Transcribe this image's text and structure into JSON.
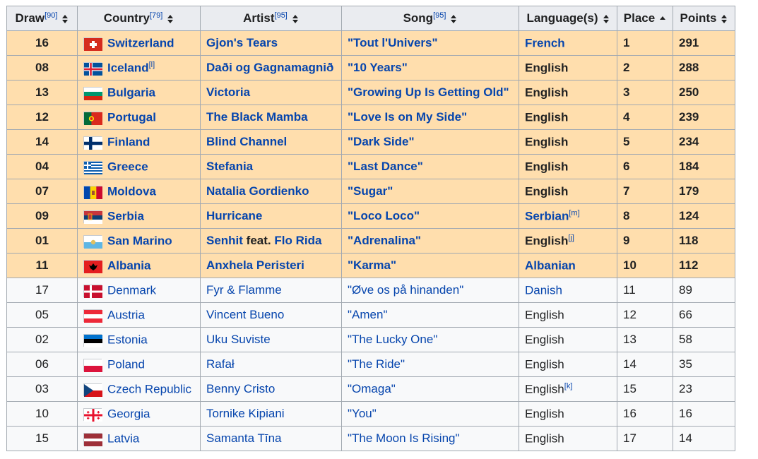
{
  "headers": [
    {
      "label": "Draw",
      "ref": "[90]",
      "sort": "both"
    },
    {
      "label": "Country",
      "ref": "[79]",
      "sort": "both"
    },
    {
      "label": "Artist",
      "ref": "[95]",
      "sort": "both"
    },
    {
      "label": "Song",
      "ref": "[95]",
      "sort": "both"
    },
    {
      "label": "Language(s)",
      "ref": "",
      "sort": "both"
    },
    {
      "label": "Place",
      "ref": "",
      "sort": "asc"
    },
    {
      "label": "Points",
      "ref": "",
      "sort": "both"
    }
  ],
  "rows": [
    {
      "draw": "16",
      "country": "Switzerland",
      "country_ref": "",
      "flag": "switzerland",
      "artist": "Gjon's Tears",
      "artist_feat": "",
      "artist_feat2": "",
      "song": "\"Tout l'Univers\"",
      "language": "French",
      "language_link": true,
      "language_ref": "",
      "place": "1",
      "points": "291",
      "qualified": true
    },
    {
      "draw": "08",
      "country": "Iceland",
      "country_ref": "[l]",
      "flag": "iceland",
      "artist": "Daði og Gagnamagnið",
      "artist_feat": "",
      "artist_feat2": "",
      "song": "\"10 Years\"",
      "language": "English",
      "language_link": false,
      "language_ref": "",
      "place": "2",
      "points": "288",
      "qualified": true
    },
    {
      "draw": "13",
      "country": "Bulgaria",
      "country_ref": "",
      "flag": "bulgaria",
      "artist": "Victoria",
      "artist_feat": "",
      "artist_feat2": "",
      "song": "\"Growing Up Is Getting Old\"",
      "language": "English",
      "language_link": false,
      "language_ref": "",
      "place": "3",
      "points": "250",
      "qualified": true
    },
    {
      "draw": "12",
      "country": "Portugal",
      "country_ref": "",
      "flag": "portugal",
      "artist": "The Black Mamba",
      "artist_feat": "",
      "artist_feat2": "",
      "song": "\"Love Is on My Side\"",
      "language": "English",
      "language_link": false,
      "language_ref": "",
      "place": "4",
      "points": "239",
      "qualified": true
    },
    {
      "draw": "14",
      "country": "Finland",
      "country_ref": "",
      "flag": "finland",
      "artist": "Blind Channel",
      "artist_feat": "",
      "artist_feat2": "",
      "song": "\"Dark Side\"",
      "language": "English",
      "language_link": false,
      "language_ref": "",
      "place": "5",
      "points": "234",
      "qualified": true
    },
    {
      "draw": "04",
      "country": "Greece",
      "country_ref": "",
      "flag": "greece",
      "artist": "Stefania",
      "artist_feat": "",
      "artist_feat2": "",
      "song": "\"Last Dance\"",
      "language": "English",
      "language_link": false,
      "language_ref": "",
      "place": "6",
      "points": "184",
      "qualified": true
    },
    {
      "draw": "07",
      "country": "Moldova",
      "country_ref": "",
      "flag": "moldova",
      "artist": "Natalia Gordienko",
      "artist_feat": "",
      "artist_feat2": "",
      "song": "\"Sugar\"",
      "language": "English",
      "language_link": false,
      "language_ref": "",
      "place": "7",
      "points": "179",
      "qualified": true
    },
    {
      "draw": "09",
      "country": "Serbia",
      "country_ref": "",
      "flag": "serbia",
      "artist": "Hurricane",
      "artist_feat": "",
      "artist_feat2": "",
      "song": "\"Loco Loco\"",
      "language": "Serbian",
      "language_link": true,
      "language_ref": "[m]",
      "place": "8",
      "points": "124",
      "qualified": true
    },
    {
      "draw": "01",
      "country": "San Marino",
      "country_ref": "",
      "flag": "sanmarino",
      "artist": "Senhit",
      "artist_feat": " feat. ",
      "artist_feat2": "Flo Rida",
      "song": "\"Adrenalina\"",
      "language": "English",
      "language_link": false,
      "language_ref": "[j]",
      "place": "9",
      "points": "118",
      "qualified": true
    },
    {
      "draw": "11",
      "country": "Albania",
      "country_ref": "",
      "flag": "albania",
      "artist": "Anxhela Peristeri",
      "artist_feat": "",
      "artist_feat2": "",
      "song": "\"Karma\"",
      "language": "Albanian",
      "language_link": true,
      "language_ref": "",
      "place": "10",
      "points": "112",
      "qualified": true
    },
    {
      "draw": "17",
      "country": "Denmark",
      "country_ref": "",
      "flag": "denmark",
      "artist": "Fyr & Flamme",
      "artist_feat": "",
      "artist_feat2": "",
      "song": "\"Øve os på hinanden\"",
      "language": "Danish",
      "language_link": true,
      "language_ref": "",
      "place": "11",
      "points": "89",
      "qualified": false
    },
    {
      "draw": "05",
      "country": "Austria",
      "country_ref": "",
      "flag": "austria",
      "artist": "Vincent Bueno",
      "artist_feat": "",
      "artist_feat2": "",
      "song": "\"Amen\"",
      "language": "English",
      "language_link": false,
      "language_ref": "",
      "place": "12",
      "points": "66",
      "qualified": false
    },
    {
      "draw": "02",
      "country": "Estonia",
      "country_ref": "",
      "flag": "estonia",
      "artist": "Uku Suviste",
      "artist_feat": "",
      "artist_feat2": "",
      "song": "\"The Lucky One\"",
      "language": "English",
      "language_link": false,
      "language_ref": "",
      "place": "13",
      "points": "58",
      "qualified": false
    },
    {
      "draw": "06",
      "country": "Poland",
      "country_ref": "",
      "flag": "poland",
      "artist": "Rafał",
      "artist_feat": "",
      "artist_feat2": "",
      "song": "\"The Ride\"",
      "language": "English",
      "language_link": false,
      "language_ref": "",
      "place": "14",
      "points": "35",
      "qualified": false
    },
    {
      "draw": "03",
      "country": "Czech Republic",
      "country_ref": "",
      "flag": "czech",
      "artist": "Benny Cristo",
      "artist_feat": "",
      "artist_feat2": "",
      "song": "\"Omaga\"",
      "language": "English",
      "language_link": false,
      "language_ref": "[k]",
      "place": "15",
      "points": "23",
      "qualified": false
    },
    {
      "draw": "10",
      "country": "Georgia",
      "country_ref": "",
      "flag": "georgia",
      "artist": "Tornike Kipiani",
      "artist_feat": "",
      "artist_feat2": "",
      "song": "\"You\"",
      "language": "English",
      "language_link": false,
      "language_ref": "",
      "place": "16",
      "points": "16",
      "qualified": false
    },
    {
      "draw": "15",
      "country": "Latvia",
      "country_ref": "",
      "flag": "latvia",
      "artist": "Samanta Tīna",
      "artist_feat": "",
      "artist_feat2": "",
      "song": "\"The Moon Is Rising\"",
      "language": "English",
      "language_link": false,
      "language_ref": "",
      "place": "17",
      "points": "14",
      "qualified": false
    }
  ],
  "colors": {
    "qualified_row": "#ffdead",
    "plain_row": "#f8f9fa",
    "header": "#eaecf0",
    "link": "#0645ad",
    "border": "#a2a9b1"
  }
}
